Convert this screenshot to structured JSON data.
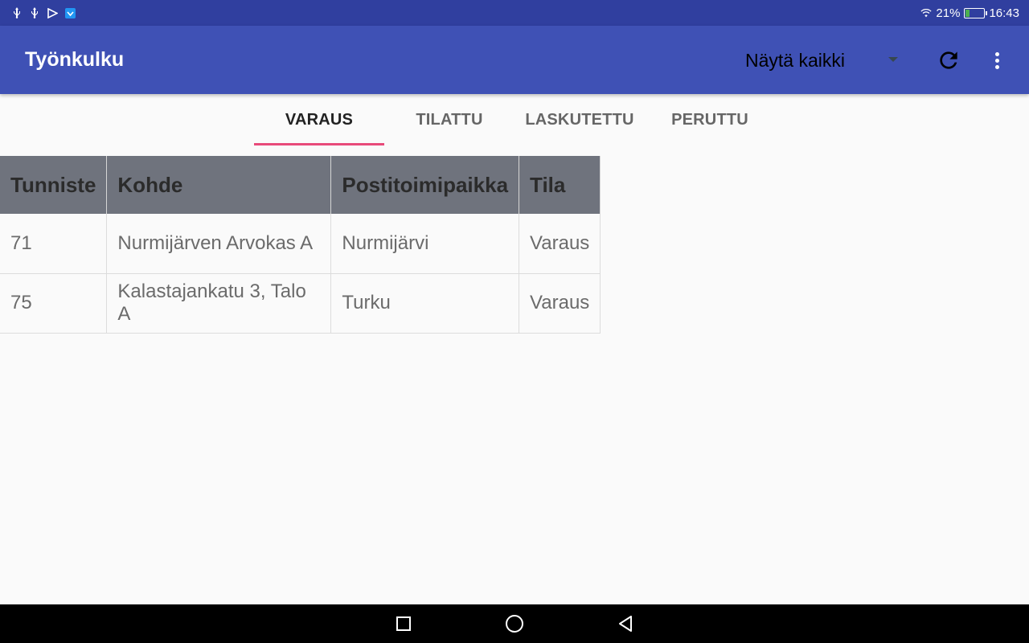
{
  "status_bar": {
    "battery": "21%",
    "battery_level": 0.21,
    "time": "16:43",
    "icons": [
      "usb-icon",
      "usb-icon",
      "play-store-icon",
      "app-notification-icon",
      "wifi-icon",
      "battery-icon"
    ]
  },
  "app_bar": {
    "title": "Työnkulku",
    "filter_selected": "Näytä kaikki",
    "refresh_icon": "refresh-icon",
    "menu_icon": "more-vert-icon",
    "color": "#3f51b5",
    "status_color": "#303f9f"
  },
  "tabs": [
    {
      "label": "VARAUS",
      "active": true
    },
    {
      "label": "TILATTU",
      "active": false
    },
    {
      "label": "LASKUTETTU",
      "active": false
    },
    {
      "label": "PERUTTU",
      "active": false
    }
  ],
  "tab_indicator_color": "#e84a7a",
  "table": {
    "headers": [
      "Tunniste",
      "Kohde",
      "Postitoimipaikka",
      "Tila"
    ],
    "rows": [
      [
        "71",
        "Nurmijärven Arvokas A",
        "Nurmijärvi",
        "Varaus"
      ],
      [
        "75",
        "Kalastajankatu 3, Talo A",
        "Turku",
        "Varaus"
      ]
    ]
  },
  "nav_bar": {
    "icons": [
      "recents-icon",
      "home-icon",
      "back-icon"
    ]
  }
}
